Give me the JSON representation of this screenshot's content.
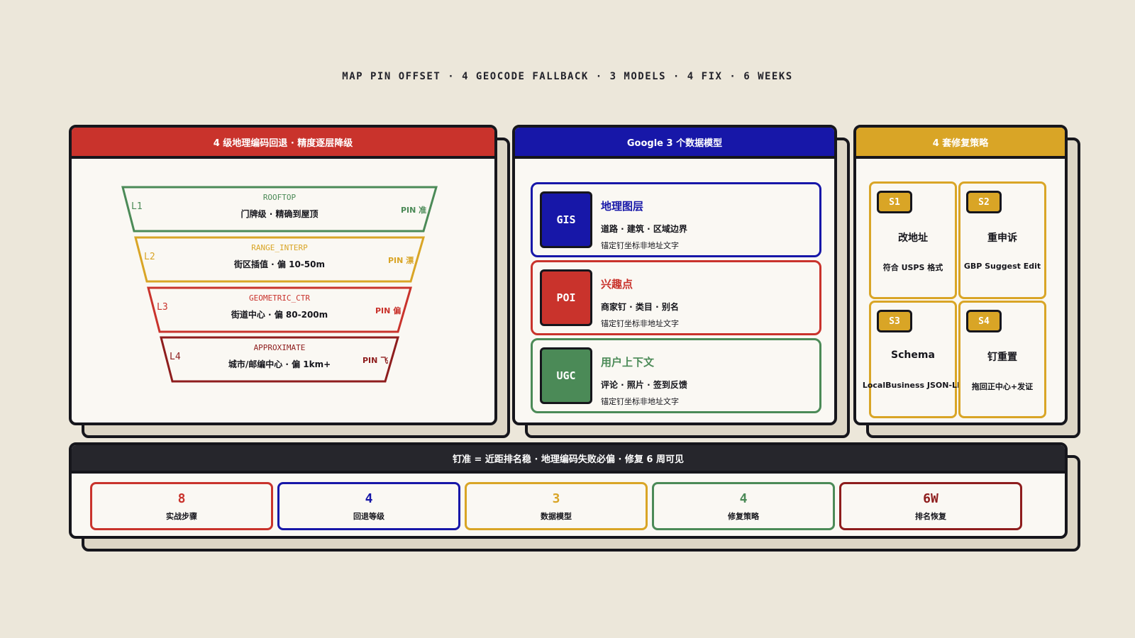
{
  "headline": "MAP PIN OFFSET · 4 GEOCODE FALLBACK · 3 MODELS · 4 FIX · 6 WEEKS",
  "colors": {
    "red": "#c9332c",
    "blue": "#1717a8",
    "gold": "#d9a526",
    "green": "#4b8a57",
    "maroon": "#8e1d1d",
    "dark": "#26262c"
  },
  "funnel": {
    "title": "4 级地理编码回退 · 精度逐层降级",
    "levels": [
      {
        "level": "L1",
        "code": "ROOFTOP",
        "desc": "门牌级 · 精确到屋顶",
        "pin": "PIN 准",
        "color": "#4b8a57"
      },
      {
        "level": "L2",
        "code": "RANGE_INTERP",
        "desc": "街区插值 · 偏 10-50m",
        "pin": "PIN 漂",
        "color": "#d9a526"
      },
      {
        "level": "L3",
        "code": "GEOMETRIC_CTR",
        "desc": "街道中心 · 偏 80-200m",
        "pin": "PIN 偏",
        "color": "#c9332c"
      },
      {
        "level": "L4",
        "code": "APPROXIMATE",
        "desc": "城市/邮编中心 · 偏 1km+",
        "pin": "PIN 飞",
        "color": "#8e1d1d"
      }
    ]
  },
  "models": {
    "title": "Google 3 个数据模型",
    "items": [
      {
        "badge": "GIS",
        "title": "地理图层",
        "desc": "道路 · 建筑 · 区域边界",
        "note": "锚定钉坐标非地址文字",
        "color": "#1717a8"
      },
      {
        "badge": "POI",
        "title": "兴趣点",
        "desc": "商家钉 · 类目 · 别名",
        "note": "锚定钉坐标非地址文字",
        "color": "#c9332c"
      },
      {
        "badge": "UGC",
        "title": "用户上下文",
        "desc": "评论 · 照片 · 签到反馈",
        "note": "锚定钉坐标非地址文字",
        "color": "#4b8a57"
      }
    ]
  },
  "fixes": {
    "title": "4 套修复策略",
    "items": [
      {
        "badge": "S1",
        "title": "改地址",
        "desc": "符合 USPS 格式"
      },
      {
        "badge": "S2",
        "title": "重申诉",
        "desc": "GBP Suggest Edit"
      },
      {
        "badge": "S3",
        "title": "Schema",
        "desc": "LocalBusiness JSON-LD"
      },
      {
        "badge": "S4",
        "title": "钉重置",
        "desc": "拖回正中心+发证"
      }
    ]
  },
  "summary": {
    "title": "钉准 = 近距排名稳 · 地理编码失败必偏 · 修复 6 周可见",
    "stats": [
      {
        "value": "8",
        "label": "实战步骤",
        "color": "#c9332c"
      },
      {
        "value": "4",
        "label": "回退等级",
        "color": "#1717a8"
      },
      {
        "value": "3",
        "label": "数据模型",
        "color": "#d9a526"
      },
      {
        "value": "4",
        "label": "修复策略",
        "color": "#4b8a57"
      },
      {
        "value": "6W",
        "label": "排名恢复",
        "color": "#8e1d1d"
      }
    ]
  }
}
